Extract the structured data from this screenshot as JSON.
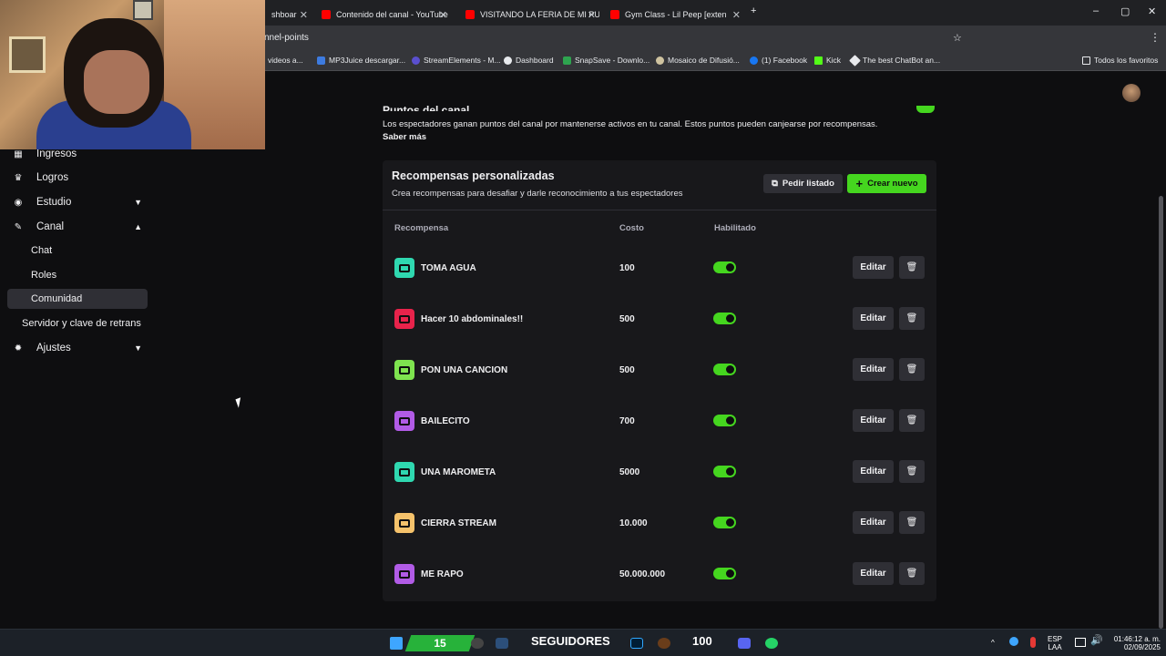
{
  "browser": {
    "tabs": [
      {
        "label": "shboar"
      },
      {
        "label": "Contenido del canal - YouTube"
      },
      {
        "label": "VISITANDO LA FERIA DE MI PU"
      },
      {
        "label": "Gym Class - Lil Peep [exten"
      }
    ],
    "url": "nnel-points",
    "bookmarks": [
      "videos a...",
      "MP3Juice descargar...",
      "StreamElements - M...",
      "Dashboard",
      "SnapSave - Downlo...",
      "Mosaico de Difusió...",
      "(1) Facebook",
      "Kick",
      "The best ChatBot an..."
    ],
    "favorites_label": "Todos los favoritos"
  },
  "sidebar": {
    "items": [
      {
        "label": "Ingresos"
      },
      {
        "label": "Logros"
      },
      {
        "label": "Estudio"
      },
      {
        "label": "Canal"
      },
      {
        "label": "Chat"
      },
      {
        "label": "Roles"
      },
      {
        "label": "Comunidad"
      },
      {
        "label": "Servidor y clave de retrans"
      },
      {
        "label": "Ajustes"
      }
    ]
  },
  "header": {
    "title": "Puntos del canal",
    "description": "Los espectadores ganan puntos del canal por mantenerse activos en tu canal. Estos puntos pueden canjearse por recompensas.",
    "learn_more": "Saber más"
  },
  "rewards": {
    "title": "Recompensas personalizadas",
    "subtitle": "Crea recompensas para desafiar y darle reconocimiento a tus espectadores",
    "request_list": "Pedir listado",
    "create_new": "Crear nuevo",
    "columns": {
      "reward": "Recompensa",
      "cost": "Costo",
      "enabled": "Habilitado"
    },
    "edit_label": "Editar",
    "items": [
      {
        "name": "TOMA AGUA",
        "cost": "100",
        "enabled": true,
        "color": "#2fd8b0"
      },
      {
        "name": "Hacer 10 abdominales!!",
        "cost": "500",
        "enabled": true,
        "color": "#e8234b"
      },
      {
        "name": "PON UNA CANCION",
        "cost": "500",
        "enabled": true,
        "color": "#7ee34f"
      },
      {
        "name": "BAILECITO",
        "cost": "700",
        "enabled": true,
        "color": "#b15be6"
      },
      {
        "name": "UNA MAROMETA",
        "cost": "5000",
        "enabled": true,
        "color": "#2fd8b0"
      },
      {
        "name": "CIERRA STREAM",
        "cost": "10.000",
        "enabled": true,
        "color": "#f5c26b"
      },
      {
        "name": "ME RAPO",
        "cost": "50.000.000",
        "enabled": true,
        "color": "#b15be6"
      }
    ]
  },
  "taskbar": {
    "follow_count": "15",
    "followers_label": "SEGUIDORES",
    "count2": "100",
    "lang": "ESP",
    "lang2": "LAA",
    "time": "01:46:12 a. m.",
    "date": "02/09/2025"
  },
  "colors": {
    "accent": "#45d61f",
    "panel": "#18181b",
    "background": "#0e0e10"
  }
}
